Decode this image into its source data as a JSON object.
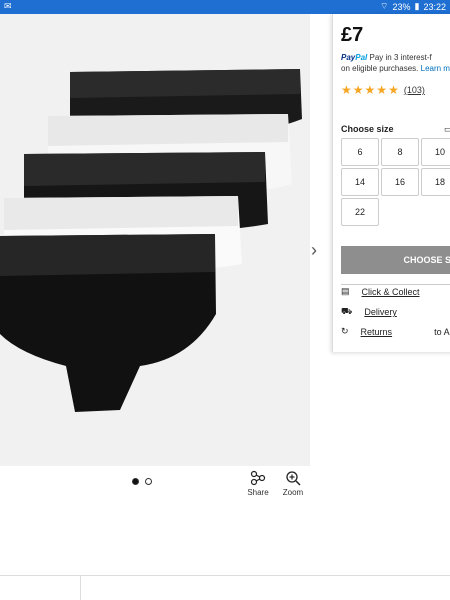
{
  "status_bar": {
    "battery": "23%",
    "time": "23:22"
  },
  "product": {
    "price": "£7",
    "paypal": {
      "brand_pay": "Pay",
      "brand_pal": "Pal",
      "line1": "Pay in 3 interest-f",
      "line2": "on eligible purchases.",
      "learn_more": "Learn m"
    },
    "rating": {
      "stars": 5,
      "count": "(103)"
    }
  },
  "sizes": {
    "label": "Choose size",
    "options": [
      "6",
      "8",
      "10",
      "14",
      "16",
      "18",
      "22"
    ]
  },
  "cta": {
    "label": "CHOOSE SIZE"
  },
  "delivery_options": [
    {
      "label": "Click & Collect",
      "icon": "store-icon"
    },
    {
      "label": "Delivery",
      "icon": "truck-icon"
    },
    {
      "label": "Returns",
      "icon": "returns-icon",
      "extra": "to As"
    }
  ],
  "gallery": {
    "dots": 2,
    "active_dot": 0,
    "share_label": "Share",
    "zoom_label": "Zoom"
  },
  "colors": {
    "accent": "#1e6fd1",
    "cta": "#8e8e8e",
    "star": "#f5a623"
  }
}
